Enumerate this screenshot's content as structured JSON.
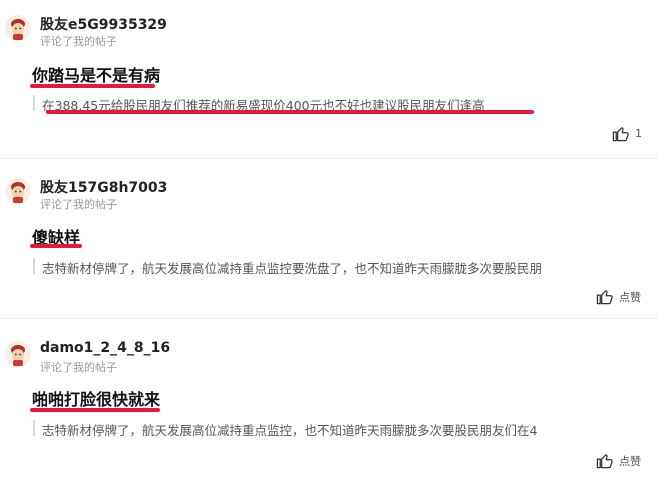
{
  "comments": [
    {
      "username": "股友e5G9935329",
      "subtitle": "评论了我的帖子",
      "title": "你踏马是不是有病",
      "quote": "在388.45元给股民朋友们推荐的新易盛现价400元也不好也建议股民朋友们逢高",
      "action_label": "1"
    },
    {
      "username": "股友157G8h7003",
      "subtitle": "评论了我的帖子",
      "title": "傻缺样",
      "quote": "志特新材停牌了，航天发展高位减持重点监控要洗盘了，也不知道昨天雨朦胧多次要股民朋",
      "action_label": "点赞"
    },
    {
      "username": "damo1_2_4_8_16",
      "subtitle": "评论了我的帖子",
      "title": "啪啪打脸很快就来",
      "quote": "志特新材停牌了，航天发展高位减持重点监控，也不知道昨天雨朦胧多次要股民朋友们在4",
      "action_label": "点赞"
    }
  ],
  "colors": {
    "highlight": "#e8173f",
    "divider": "#eeeeee"
  },
  "icons": {
    "action": "thumbs-up-icon",
    "avatar": "cartoon-avatar-icon"
  }
}
